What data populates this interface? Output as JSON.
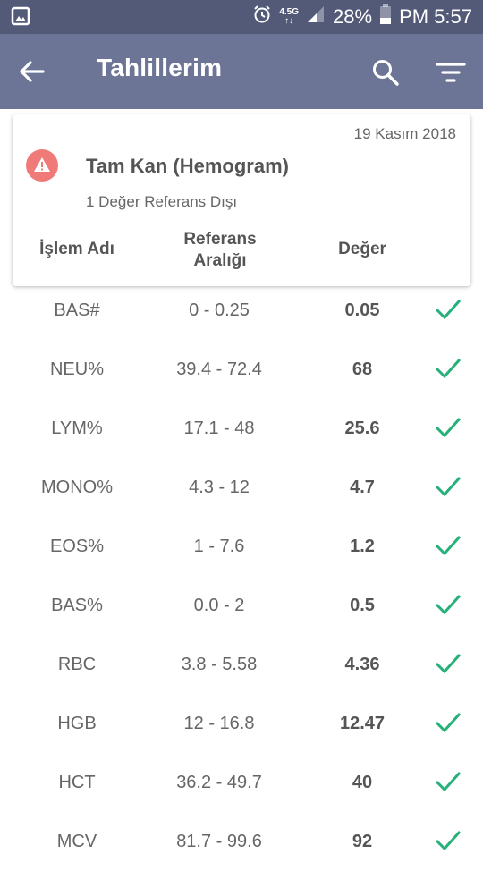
{
  "status_bar": {
    "network_label": "4.5G",
    "network_top": "4.5G",
    "network_bottom": "↑↓",
    "battery": "28%",
    "time": "PM 5:57",
    "icons": [
      "gallery-icon",
      "alarm-icon",
      "signal-icon",
      "battery-icon"
    ]
  },
  "app_bar": {
    "title": "Tahlillerim",
    "icons": [
      "back-arrow-icon",
      "search-icon",
      "filter-icon"
    ]
  },
  "card": {
    "date": "19 Kasım 2018",
    "title": "Tam Kan (Hemogram)",
    "subtitle": "1 Değer Referans Dışı",
    "warning_color": "#f07a78",
    "headers": {
      "name": "İşlem Adı",
      "ref_line1": "Referans",
      "ref_line2": "Aralığı",
      "value": "Değer"
    }
  },
  "check_color": "#26b07a",
  "rows": [
    {
      "name": "BAS#",
      "ref": "0 - 0.25",
      "value": "0.05"
    },
    {
      "name": "NEU%",
      "ref": "39.4 - 72.4",
      "value": "68"
    },
    {
      "name": "LYM%",
      "ref": "17.1 - 48",
      "value": "25.6"
    },
    {
      "name": "MONO%",
      "ref": "4.3 - 12",
      "value": "4.7"
    },
    {
      "name": "EOS%",
      "ref": "1 - 7.6",
      "value": "1.2"
    },
    {
      "name": "BAS%",
      "ref": "0.0 - 2",
      "value": "0.5"
    },
    {
      "name": "RBC",
      "ref": "3.8 - 5.58",
      "value": "4.36"
    },
    {
      "name": "HGB",
      "ref": "12 - 16.8",
      "value": "12.47"
    },
    {
      "name": "HCT",
      "ref": "36.2 - 49.7",
      "value": "40"
    },
    {
      "name": "MCV",
      "ref": "81.7 - 99.6",
      "value": "92"
    }
  ]
}
